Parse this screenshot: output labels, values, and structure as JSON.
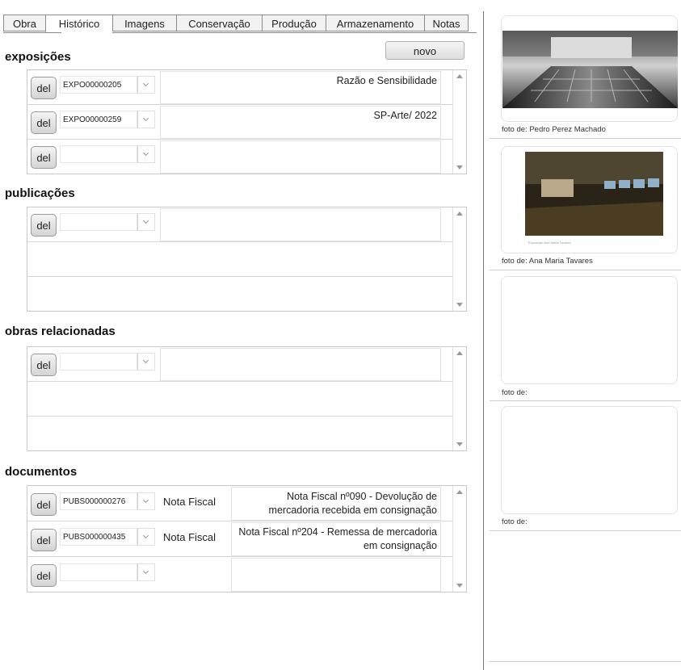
{
  "tabs": [
    "Obra",
    "Histórico",
    "Imagens",
    "Conservação",
    "Produção",
    "Armazenamento",
    "Notas"
  ],
  "active_tab": "Histórico",
  "buttons": {
    "novo": "novo",
    "del": "del"
  },
  "sections": {
    "exposicoes": {
      "title": "exposições",
      "rows": [
        {
          "code": "EXPO00000205",
          "text": "Razão e Sensibilidade"
        },
        {
          "code": "EXPO00000259",
          "text": "SP-Arte/ 2022"
        },
        {
          "code": "",
          "text": ""
        }
      ]
    },
    "publicacoes": {
      "title": "publicações",
      "rows": [
        {
          "code": "",
          "text": ""
        }
      ]
    },
    "obras_relacionadas": {
      "title": "obras relacionadas",
      "rows": [
        {
          "code": "",
          "text": ""
        }
      ]
    },
    "documentos": {
      "title": "documentos",
      "rows": [
        {
          "code": "PUBS000000276",
          "type": "Nota Fiscal",
          "text": "Nota Fiscal nº090 - Devolução de mercadoria recebida em consignação"
        },
        {
          "code": "PUBS000000435",
          "type": "Nota Fiscal",
          "text": "Nota Fiscal nº204 - Remessa de mercadoria em consignação"
        },
        {
          "code": "",
          "type": "",
          "text": ""
        }
      ]
    }
  },
  "photos": [
    {
      "caption": "foto de: Pedro Perez Machado"
    },
    {
      "caption": "foto de: Ana Maria Tavares",
      "image_text": "Exposição Ana Maria Tavares"
    },
    {
      "caption": "foto de:"
    },
    {
      "caption": "foto de:"
    }
  ]
}
